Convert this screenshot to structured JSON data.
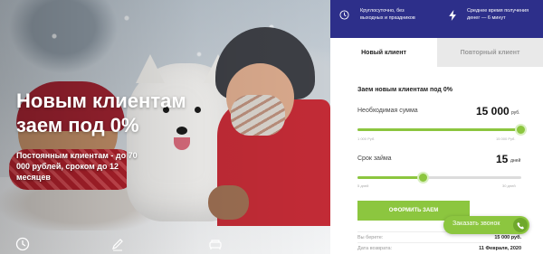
{
  "hero": {
    "title": "Новым клиентам заем под 0%",
    "subtitle": "Постоянным клиентам - до 70 000 рублей, сроком до 12 месяцев",
    "bottom_icons": [
      "clock-icon",
      "pen-icon",
      "sofa-icon"
    ]
  },
  "topbar": {
    "item1": "Круглосуточно, без выходных и праздников",
    "item1_icon": "clock-icon",
    "item2": "Среднее время получения денег — 6 минут",
    "item2_icon": "lightning-icon",
    "color": "#2d2f8a"
  },
  "tabs": [
    {
      "label": "Новый клиент",
      "active": true
    },
    {
      "label": "Повторный клиент",
      "active": false
    }
  ],
  "form": {
    "title": "Заем новым клиентам под 0%",
    "amount": {
      "label": "Необходимая сумма",
      "value": "15 000",
      "unit": "руб.",
      "min": "1 000 Руб.",
      "max": "15 000 Руб.",
      "level_percent": 100
    },
    "term": {
      "label": "Срок займа",
      "value": "15",
      "unit": "дней",
      "min": "5 дней",
      "max": "30 дней",
      "level_percent": 40
    },
    "submit": "ОФОРМИТЬ ЗАЕМ",
    "summary": [
      {
        "key": "Вы берете:",
        "value": "15 000 руб."
      },
      {
        "key": "Дата возврата:",
        "value": "11 Февраля, 2020"
      }
    ],
    "accent": "#8cc63f"
  },
  "callback": {
    "label": "Заказать звонок",
    "icon": "phone-icon"
  }
}
